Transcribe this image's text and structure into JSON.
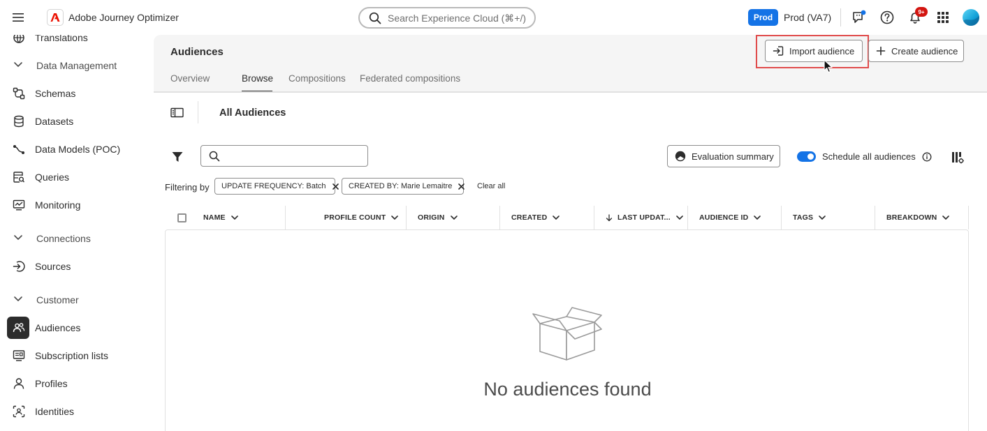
{
  "topbar": {
    "app_title": "Adobe Journey Optimizer",
    "search_placeholder": "Search Experience Cloud (⌘+/)",
    "env_badge": "Prod",
    "env_name": "Prod (VA7)",
    "notification_count": "9+"
  },
  "sidebar": {
    "partial_item": "Translations",
    "sections": [
      {
        "label": "Data Management",
        "icon": "chevron-down-icon"
      },
      {
        "label": "Connections",
        "icon": "chevron-down-icon"
      },
      {
        "label": "Customer",
        "icon": "chevron-down-icon"
      }
    ],
    "items": [
      {
        "label": "Schemas",
        "icon": "schema-icon"
      },
      {
        "label": "Datasets",
        "icon": "database-icon"
      },
      {
        "label": "Data Models (POC)",
        "icon": "data-model-icon"
      },
      {
        "label": "Queries",
        "icon": "query-icon"
      },
      {
        "label": "Monitoring",
        "icon": "monitoring-icon"
      },
      {
        "label": "Sources",
        "icon": "sources-icon"
      },
      {
        "label": "Audiences",
        "icon": "audiences-icon",
        "active": true
      },
      {
        "label": "Subscription lists",
        "icon": "subscription-icon"
      },
      {
        "label": "Profiles",
        "icon": "profile-icon"
      },
      {
        "label": "Identities",
        "icon": "identity-icon"
      }
    ]
  },
  "page": {
    "title": "Audiences",
    "import_button": "Import audience",
    "create_button": "Create audience",
    "tabs": [
      {
        "label": "Overview"
      },
      {
        "label": "Browse",
        "active": true
      },
      {
        "label": "Compositions"
      },
      {
        "label": "Federated compositions"
      }
    ]
  },
  "content": {
    "title": "All Audiences",
    "search_value": "",
    "eval_button": "Evaluation summary",
    "toggle_label": "Schedule all audiences",
    "toggle_on": true,
    "filtering_by": "Filtering by",
    "filters": [
      {
        "label": "UPDATE FREQUENCY: Batch"
      },
      {
        "label": "CREATED BY: Marie Lemaitre"
      }
    ],
    "clear_all": "Clear all",
    "columns": [
      {
        "label": "NAME"
      },
      {
        "label": "PROFILE COUNT"
      },
      {
        "label": "ORIGIN"
      },
      {
        "label": "CREATED"
      },
      {
        "label": "LAST UPDAT..."
      },
      {
        "label": "AUDIENCE ID"
      },
      {
        "label": "TAGS"
      },
      {
        "label": "BREAKDOWN"
      }
    ],
    "empty_message": "No audiences found"
  },
  "colors": {
    "accent": "#1473e6",
    "highlight": "#e04b4b",
    "notification": "#d31510"
  }
}
